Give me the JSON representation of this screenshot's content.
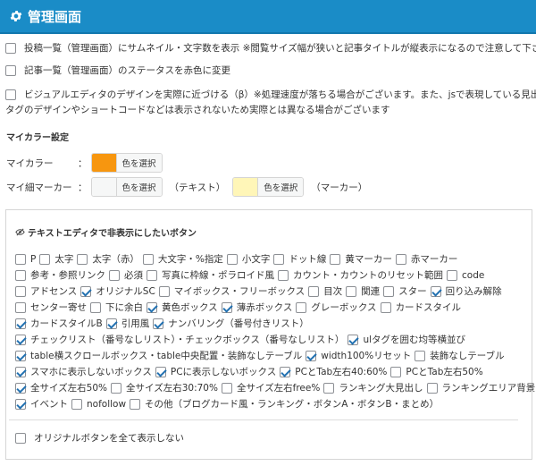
{
  "header": {
    "title": "管理画面",
    "icon": "gear-icon"
  },
  "options": [
    {
      "label": "投稿一覧（管理画面）にサムネイル・文字数を表示 ※閲覧サイズ幅が狭いと記事タイトルが縦表示になるので注意して下さい",
      "checked": false
    },
    {
      "label": "記事一覧（管理画面）のステータスを赤色に変更",
      "checked": false
    },
    {
      "label": "ビジュアルエディタのデザインを実際に近づける（β）※処理速度が落ちる場合がございます。また、jsで表現している見出し",
      "label2": "タグのデザインやショートコードなどは表示されないため実際とは異なる場合がございます",
      "checked": false
    }
  ],
  "my_color": {
    "section_title": "マイカラー設定",
    "main": {
      "label": "マイカラー",
      "colon": "：",
      "color": "#f7960f",
      "button": "色を選択"
    },
    "sub": {
      "label": "マイ細マーカー",
      "colon": "：",
      "color": "#f6f7f7",
      "button": "色を選択",
      "text_note": "（テキスト）",
      "marker_color": "#fff6b8",
      "marker_button": "色を選択",
      "marker_note": "（マーカー）"
    }
  },
  "hidden_buttons": {
    "title": "テキストエディタで非表示にしたいボタン",
    "rows": [
      [
        {
          "label": "P",
          "checked": false
        },
        {
          "label": "太字",
          "checked": false
        },
        {
          "label": "太字（赤）",
          "checked": false
        },
        {
          "label": "大文字・%指定",
          "checked": false
        },
        {
          "label": "小文字",
          "checked": false
        },
        {
          "label": "ドット線",
          "checked": false
        },
        {
          "label": "黄マーカー",
          "checked": false
        },
        {
          "label": "赤マーカー",
          "checked": false
        }
      ],
      [
        {
          "label": "参考・参照リンク",
          "checked": false
        },
        {
          "label": "必須",
          "checked": false
        },
        {
          "label": "写真に枠線・ポラロイド風",
          "checked": false
        },
        {
          "label": "カウント・カウントのリセット範囲",
          "checked": false
        },
        {
          "label": "code",
          "checked": false
        }
      ],
      [
        {
          "label": "アドセンス",
          "checked": false
        },
        {
          "label": "オリジナルSC",
          "checked": true
        },
        {
          "label": "マイボックス・フリーボックス",
          "checked": false
        },
        {
          "label": "目次",
          "checked": false
        },
        {
          "label": "関連",
          "checked": false
        },
        {
          "label": "スター",
          "checked": false
        },
        {
          "label": "回り込み解除",
          "checked": true
        }
      ],
      [
        {
          "label": "センター寄せ",
          "checked": false
        },
        {
          "label": "下に余白",
          "checked": false
        },
        {
          "label": "黄色ボックス",
          "checked": true
        },
        {
          "label": "薄赤ボックス",
          "checked": true
        },
        {
          "label": "グレーボックス",
          "checked": false
        },
        {
          "label": "カードスタイル",
          "checked": false
        }
      ],
      [
        {
          "label": "カードスタイルB",
          "checked": true
        },
        {
          "label": "引用風",
          "checked": true
        },
        {
          "label": "ナンバリング（番号付きリスト）",
          "checked": true
        }
      ],
      [
        {
          "label": "チェックリスト（番号なしリスト）・チェックボックス（番号なしリスト）",
          "checked": true
        },
        {
          "label": "ulタグを囲む均等横並び",
          "checked": true
        }
      ],
      [
        {
          "label": "table横スクロールボックス・table中央配置・装飾なしテーブル",
          "checked": true
        },
        {
          "label": "width100%リセット",
          "checked": true
        },
        {
          "label": "装飾なしテーブル",
          "checked": false
        }
      ],
      [
        {
          "label": "スマホに表示しないボックス",
          "checked": true
        },
        {
          "label": "PCに表示しないボックス",
          "checked": true
        },
        {
          "label": "PCとTab左右40:60%",
          "checked": true
        },
        {
          "label": "PCとTab左右50%",
          "checked": false
        }
      ],
      [
        {
          "label": "全サイズ左右50%",
          "checked": true
        },
        {
          "label": "全サイズ左右30:70%",
          "checked": false
        },
        {
          "label": "全サイズ左右free%",
          "checked": false
        },
        {
          "label": "ランキング大見出し",
          "checked": false
        },
        {
          "label": "ランキングエリア背景",
          "checked": false
        }
      ],
      [
        {
          "label": "イベント",
          "checked": true
        },
        {
          "label": "nofollow",
          "checked": false
        },
        {
          "label": "その他（ブログカード風・ランキング・ボタンA・ボタンB・まとめ）",
          "checked": false
        }
      ]
    ],
    "hide_all": {
      "label": "オリジナルボタンを全て表示しない",
      "checked": false
    }
  }
}
